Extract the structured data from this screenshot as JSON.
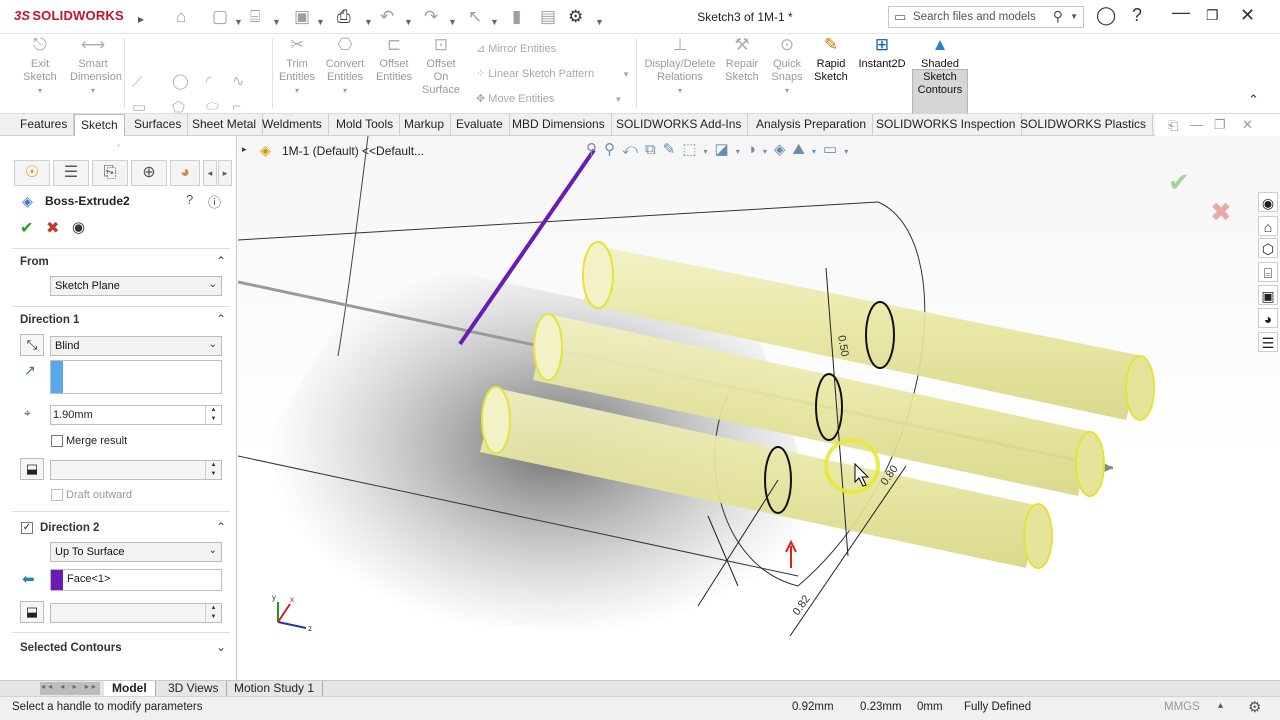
{
  "app": {
    "logo_prefix": "3S",
    "logo": "SOLIDWORKS"
  },
  "window": {
    "title": "Sketch3 of 1M-1 *"
  },
  "search": {
    "placeholder": "Search files and models"
  },
  "commands": {
    "exit_sketch": "Exit Sketch",
    "smart_dimension": "Smart Dimension",
    "trim_entities": "Trim Entities",
    "convert_entities": "Convert Entities",
    "offset_entities": "Offset Entities",
    "offset_on_surface": "Offset On Surface",
    "mirror_entities": "Mirror Entities",
    "linear_sketch_pattern": "Linear Sketch Pattern",
    "move_entities": "Move Entities",
    "display_delete_relations": "Display/Delete Relations",
    "repair_sketch": "Repair Sketch",
    "quick_snaps": "Quick Snaps",
    "rapid_sketch": "Rapid Sketch",
    "instant2d": "Instant2D",
    "shaded_sketch_contours": "Shaded Sketch Contours"
  },
  "tabs": [
    "Features",
    "Sketch",
    "Surfaces",
    "Sheet Metal",
    "Weldments",
    "Mold Tools",
    "Markup",
    "Evaluate",
    "MBD Dimensions",
    "SOLIDWORKS Add-Ins",
    "Analysis Preparation",
    "SOLIDWORKS Inspection",
    "SOLIDWORKS Plastics"
  ],
  "active_tab": "Sketch",
  "feature_tree": {
    "item": "1M-1 (Default) <<Default..."
  },
  "panel": {
    "title": "Boss-Extrude2",
    "from_label": "From",
    "from_value": "Sketch Plane",
    "direction1_label": "Direction 1",
    "direction1_type": "Blind",
    "depth_value": "1.90mm",
    "merge_result": "Merge result",
    "draft_outward": "Draft outward",
    "direction2_label": "Direction 2",
    "direction2_type": "Up To Surface",
    "direction2_face": "Face<1>",
    "selected_contours": "Selected Contours"
  },
  "dims": {
    "d1": "0.50",
    "d2": "0.80",
    "d3": "0.82"
  },
  "bottom_tabs": [
    "Model",
    "3D Views",
    "Motion Study 1"
  ],
  "status": {
    "message": "Select a handle to modify parameters",
    "x": "0.92mm",
    "y": "0.23mm",
    "z": "0mm",
    "state": "Fully Defined",
    "units": "MMGS"
  },
  "colors": {
    "accent_purple": "#6a1bb5",
    "cylinder_fill": "#e9e8a8",
    "cylinder_edge": "#e3e33a"
  }
}
